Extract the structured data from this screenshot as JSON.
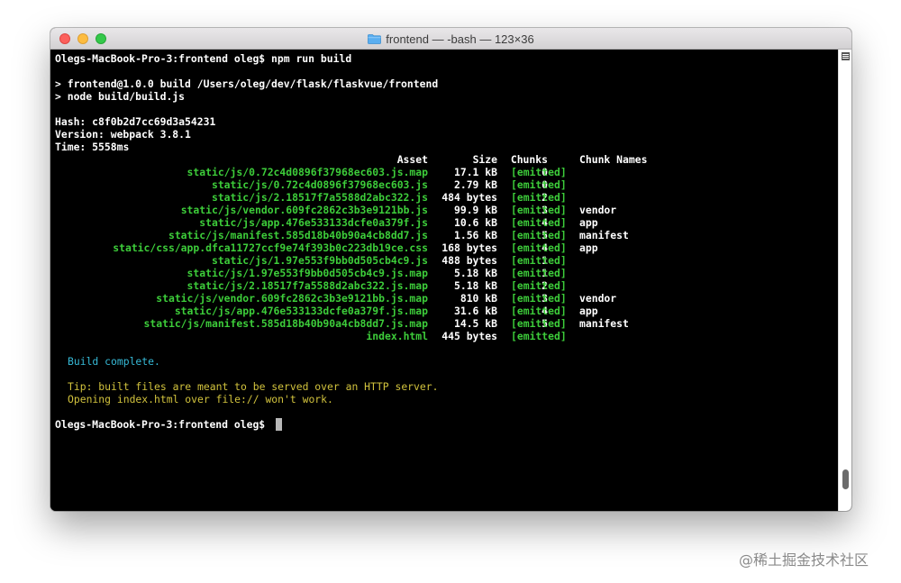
{
  "window": {
    "title": "frontend — -bash — 123×36",
    "icons": {
      "folder": "folder-icon"
    },
    "colors": {
      "close": "#fc605c",
      "minimize": "#fdbc40",
      "maximize": "#34c84a"
    }
  },
  "terminal": {
    "prompt_line": "Olegs-MacBook-Pro-3:frontend oleg$ npm run build",
    "script_line_1": "> frontend@1.0.0 build /Users/oleg/dev/flask/flaskvue/frontend",
    "script_line_2": "> node build/build.js",
    "hash_label": "Hash: ",
    "hash_value": "c8f0b2d7cc69d3a54231",
    "version_label": "Version: webpack ",
    "version_value": "3.8.1",
    "time_label": "Time: ",
    "time_value": "5558ms",
    "table": {
      "headers": {
        "asset": "Asset",
        "size": "Size",
        "chunks": "Chunks",
        "chunk_names": "Chunk Names"
      },
      "rows": [
        {
          "asset": "static/js/0.72c4d0896f37968ec603.js.map",
          "size": "17.1 kB",
          "chunks": "0",
          "emitted": "[emitted]",
          "name": ""
        },
        {
          "asset": "static/js/0.72c4d0896f37968ec603.js",
          "size": "2.79 kB",
          "chunks": "0",
          "emitted": "[emitted]",
          "name": ""
        },
        {
          "asset": "static/js/2.18517f7a5588d2abc322.js",
          "size": "484 bytes",
          "chunks": "2",
          "emitted": "[emitted]",
          "name": ""
        },
        {
          "asset": "static/js/vendor.609fc2862c3b3e9121bb.js",
          "size": "99.9 kB",
          "chunks": "3",
          "emitted": "[emitted]",
          "name": "vendor"
        },
        {
          "asset": "static/js/app.476e533133dcfe0a379f.js",
          "size": "10.6 kB",
          "chunks": "4",
          "emitted": "[emitted]",
          "name": "app"
        },
        {
          "asset": "static/js/manifest.585d18b40b90a4cb8dd7.js",
          "size": "1.56 kB",
          "chunks": "5",
          "emitted": "[emitted]",
          "name": "manifest"
        },
        {
          "asset": "static/css/app.dfca11727ccf9e74f393b0c223db19ce.css",
          "size": "168 bytes",
          "chunks": "4",
          "emitted": "[emitted]",
          "name": "app"
        },
        {
          "asset": "static/js/1.97e553f9bb0d505cb4c9.js",
          "size": "488 bytes",
          "chunks": "1",
          "emitted": "[emitted]",
          "name": ""
        },
        {
          "asset": "static/js/1.97e553f9bb0d505cb4c9.js.map",
          "size": "5.18 kB",
          "chunks": "1",
          "emitted": "[emitted]",
          "name": ""
        },
        {
          "asset": "static/js/2.18517f7a5588d2abc322.js.map",
          "size": "5.18 kB",
          "chunks": "2",
          "emitted": "[emitted]",
          "name": ""
        },
        {
          "asset": "static/js/vendor.609fc2862c3b3e9121bb.js.map",
          "size": "810 kB",
          "chunks": "3",
          "emitted": "[emitted]",
          "name": "vendor"
        },
        {
          "asset": "static/js/app.476e533133dcfe0a379f.js.map",
          "size": "31.6 kB",
          "chunks": "4",
          "emitted": "[emitted]",
          "name": "app"
        },
        {
          "asset": "static/js/manifest.585d18b40b90a4cb8dd7.js.map",
          "size": "14.5 kB",
          "chunks": "5",
          "emitted": "[emitted]",
          "name": "manifest"
        },
        {
          "asset": "index.html",
          "size": "445 bytes",
          "chunks": "",
          "emitted": "[emitted]",
          "name": ""
        }
      ]
    },
    "build_complete": "Build complete.",
    "tip_line_1": "Tip: built files are meant to be served over an HTTP server.",
    "tip_line_2": "Opening index.html over file:// won't work.",
    "final_prompt": "Olegs-MacBook-Pro-3:frontend oleg$ ",
    "colors": {
      "asset_green": "#3dcd3a",
      "complete_cyan": "#36b9d6",
      "tip_yellow": "#d1c23d",
      "background": "#000000"
    }
  },
  "watermark": "@稀土掘金技术社区"
}
